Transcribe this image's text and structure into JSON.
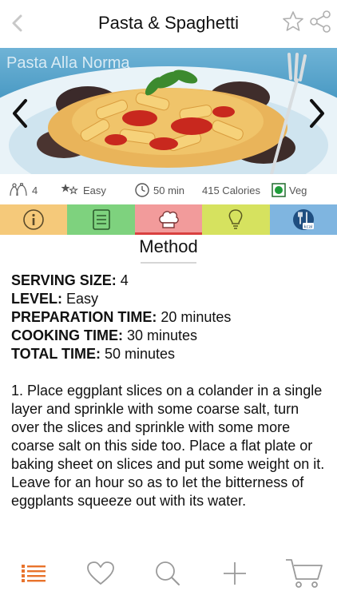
{
  "header": {
    "title": "Pasta & Spaghetti",
    "back_icon": "chevron-left-icon",
    "favorite_icon": "star-outline-icon",
    "share_icon": "share-icon"
  },
  "hero": {
    "caption": "Pasta Alla Norma",
    "prev_icon": "chevron-left-icon",
    "next_icon": "chevron-right-icon"
  },
  "info": {
    "servings": "4",
    "level": "Easy",
    "time": "50 min",
    "calories": "415 Calories",
    "diet": "Veg"
  },
  "tabs": [
    {
      "name": "info",
      "icon": "info-icon",
      "color": "#f5c97a"
    },
    {
      "name": "ingredients",
      "icon": "list-icon",
      "color": "#7ed27e"
    },
    {
      "name": "method",
      "icon": "chef-hat-icon",
      "color": "#f29b9b",
      "active": true
    },
    {
      "name": "tips",
      "icon": "lightbulb-icon",
      "color": "#d6e25f"
    },
    {
      "name": "nutrition",
      "icon": "kcal-icon",
      "color": "#7fb5e0"
    }
  ],
  "section_title": "Method",
  "details": {
    "serving_label": "SERVING SIZE:",
    "serving_value": " 4",
    "level_label": "LEVEL:",
    "level_value": " Easy",
    "prep_label": "PREPARATION TIME:",
    "prep_value": " 20 minutes",
    "cook_label": "COOKING TIME:",
    "cook_value": " 30 minutes",
    "total_label": "TOTAL TIME:",
    "total_value": " 50 minutes"
  },
  "step_1": "1. Place eggplant slices on a colander in a single layer and sprinkle with some coarse salt, turn over the slices and sprinkle with some more coarse salt on this side too. Place a flat plate or baking sheet on slices and put some weight on it. Leave for an hour so as to let the bitterness of eggplants squeeze out with its water.",
  "bottom_bar": [
    {
      "name": "recipes",
      "icon": "list-icon",
      "color": "#e8732c"
    },
    {
      "name": "favorites",
      "icon": "heart-icon",
      "color": "#9a9a9a"
    },
    {
      "name": "search",
      "icon": "search-icon",
      "color": "#9a9a9a"
    },
    {
      "name": "add",
      "icon": "plus-icon",
      "color": "#9a9a9a"
    },
    {
      "name": "cart",
      "icon": "cart-icon",
      "color": "#9a9a9a"
    }
  ],
  "colors": {
    "accent_orange": "#e8732c",
    "active_tab_bar": "#d9403f",
    "veg_green": "#1f9d3a"
  }
}
